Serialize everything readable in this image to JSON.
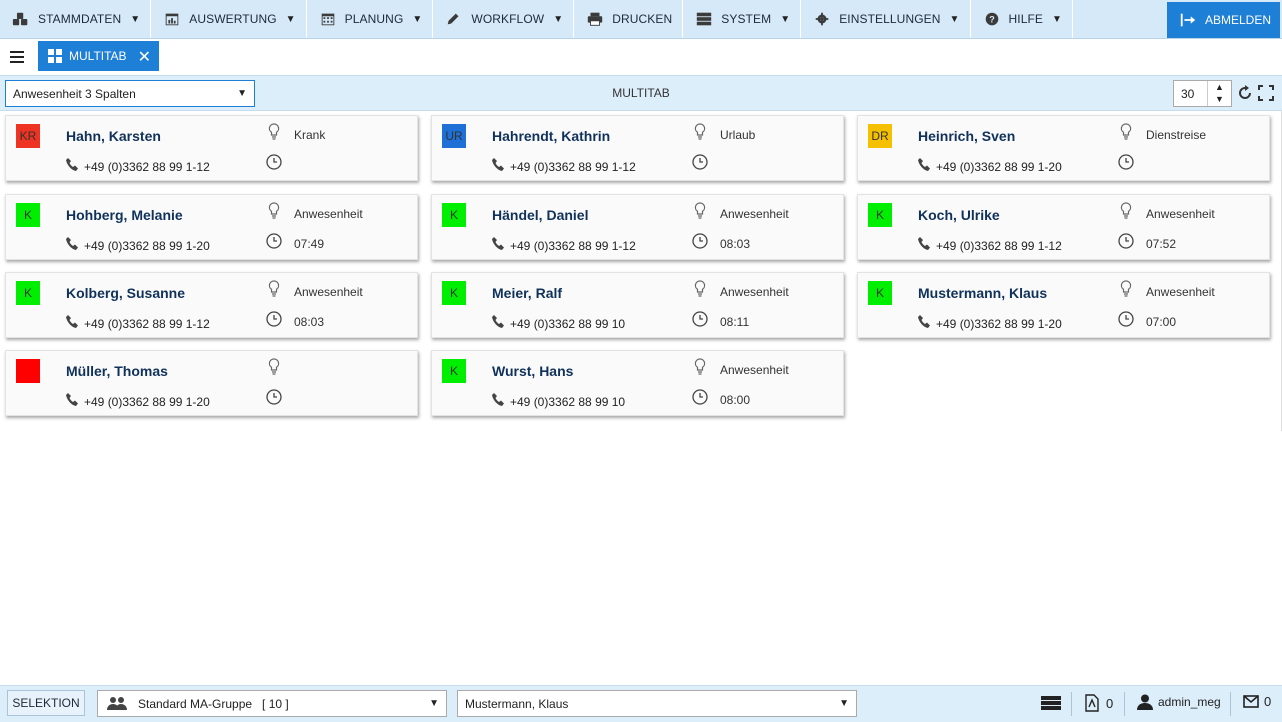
{
  "menu": {
    "items": [
      {
        "label": "STAMMDATEN",
        "icon": "cubes-icon"
      },
      {
        "label": "AUSWERTUNG",
        "icon": "calendar-chart-icon"
      },
      {
        "label": "PLANUNG",
        "icon": "calendar-icon"
      },
      {
        "label": "WORKFLOW",
        "icon": "pencil-icon"
      },
      {
        "label": "DRUCKEN",
        "icon": "printer-icon"
      },
      {
        "label": "SYSTEM",
        "icon": "server-icon"
      },
      {
        "label": "EINSTELLUNGEN",
        "icon": "gear-icon"
      },
      {
        "label": "HILFE",
        "icon": "question-icon"
      }
    ],
    "logout_label": "ABMELDEN"
  },
  "tab": {
    "label": "MULTITAB"
  },
  "toolbar": {
    "view_select": "Anwesenheit 3 Spalten",
    "title": "MULTITAB",
    "count": "30"
  },
  "colors": {
    "accent": "#1e7fd6",
    "bar": "#ddeefb",
    "present": "#00ee00",
    "sick": "#ee3322",
    "vacation": "#1e6fd6",
    "trip": "#f5c000",
    "absent": "#ff0000"
  },
  "employees": [
    {
      "badge": "KR",
      "badge_color": "#ee3322",
      "name": "Hahn, Karsten",
      "phone": "+49 (0)3362 88 99 1-12",
      "status": "Krank",
      "time": ""
    },
    {
      "badge": "UR",
      "badge_color": "#1e6fd6",
      "name": "Hahrendt, Kathrin",
      "phone": "+49 (0)3362 88 99 1-12",
      "status": "Urlaub",
      "time": ""
    },
    {
      "badge": "DR",
      "badge_color": "#f5c000",
      "name": "Heinrich, Sven",
      "phone": "+49 (0)3362 88 99 1-20",
      "status": "Dienstreise",
      "time": ""
    },
    {
      "badge": "K",
      "badge_color": "#00ee00",
      "name": "Hohberg, Melanie",
      "phone": "+49 (0)3362 88 99 1-20",
      "status": "Anwesenheit",
      "time": "07:49"
    },
    {
      "badge": "K",
      "badge_color": "#00ee00",
      "name": "Händel, Daniel",
      "phone": "+49 (0)3362 88 99 1-12",
      "status": "Anwesenheit",
      "time": "08:03"
    },
    {
      "badge": "K",
      "badge_color": "#00ee00",
      "name": "Koch, Ulrike",
      "phone": "+49 (0)3362 88 99 1-12",
      "status": "Anwesenheit",
      "time": "07:52"
    },
    {
      "badge": "K",
      "badge_color": "#00ee00",
      "name": "Kolberg, Susanne",
      "phone": "+49 (0)3362 88 99 1-12",
      "status": "Anwesenheit",
      "time": "08:03"
    },
    {
      "badge": "K",
      "badge_color": "#00ee00",
      "name": "Meier, Ralf",
      "phone": "+49 (0)3362 88 99 10",
      "status": "Anwesenheit",
      "time": "08:11"
    },
    {
      "badge": "K",
      "badge_color": "#00ee00",
      "name": "Mustermann, Klaus",
      "phone": "+49 (0)3362 88 99 1-20",
      "status": "Anwesenheit",
      "time": "07:00"
    },
    {
      "badge": "",
      "badge_color": "#ff0000",
      "name": "Müller, Thomas",
      "phone": "+49 (0)3362 88 99 1-20",
      "status": "",
      "time": ""
    },
    {
      "badge": "K",
      "badge_color": "#00ee00",
      "name": "Wurst, Hans",
      "phone": "+49 (0)3362 88 99 10",
      "status": "Anwesenheit",
      "time": "08:00"
    }
  ],
  "statusbar": {
    "selektion_label": "SELEKTION",
    "group_select": "Standard MA-Gruppe   [ 10 ]",
    "person_select": "Mustermann, Klaus",
    "pdf_count": "0",
    "user": "admin_meg",
    "mail_count": "0"
  }
}
